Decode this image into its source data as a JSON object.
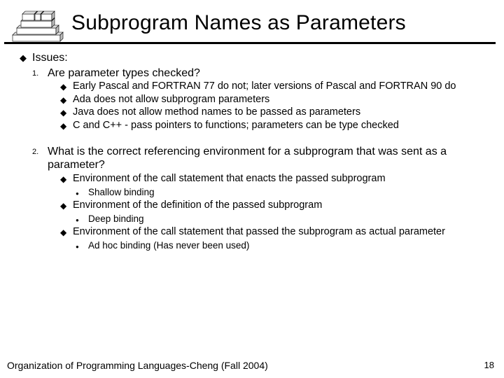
{
  "header": {
    "title": "Subprogram Names as Parameters"
  },
  "issues_label": "Issues:",
  "q1": {
    "num": "1.",
    "text": "Are parameter types checked?",
    "points": [
      "Early Pascal and FORTRAN 77 do not; later versions of Pascal and FORTRAN 90 do",
      "Ada does not allow subprogram parameters",
      "Java does not allow method names to be passed as parameters",
      "C and C++ - pass pointers to functions; parameters can be type checked"
    ]
  },
  "q2": {
    "num": "2.",
    "text": "What is the correct referencing environment for a subprogram that was sent as a parameter?",
    "envs": [
      {
        "text": "Environment of the call statement that enacts the passed subprogram",
        "binding": "Shallow binding"
      },
      {
        "text": "Environment of the definition of the passed subprogram",
        "binding": "Deep binding"
      },
      {
        "text": "Environment of the call statement that passed the subprogram as actual parameter",
        "binding": "Ad hoc binding (Has never been used)"
      }
    ]
  },
  "footer": {
    "text": "Organization of Programming Languages-Cheng (Fall 2004)",
    "page": "18"
  }
}
